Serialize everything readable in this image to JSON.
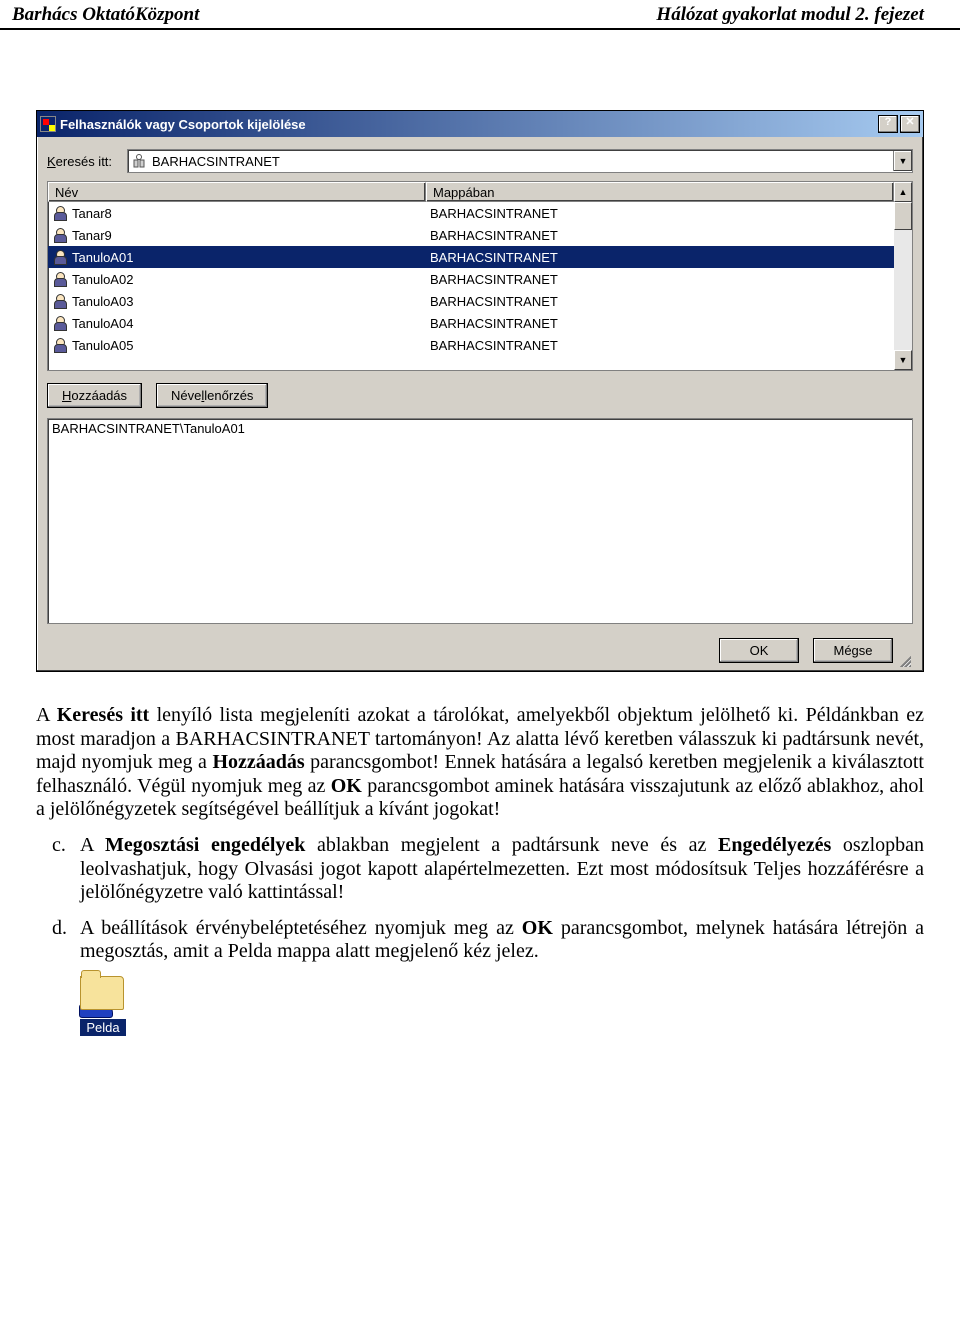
{
  "header": {
    "left": "Barhács OktatóKözpont",
    "right": "Hálózat gyakorlat modul 2. fejezet"
  },
  "dialog": {
    "title": "Felhasználók vagy Csoportok kijelölése",
    "help_btn": "?",
    "close_btn": "✕",
    "search_in_label_pre": "K",
    "search_in_label_post": "eresés itt:",
    "search_in_value": "BARHACSINTRANET",
    "col_name": "Név",
    "col_folder": "Mappában",
    "rows": [
      {
        "name": "Tanar8",
        "folder": "BARHACSINTRANET"
      },
      {
        "name": "Tanar9",
        "folder": "BARHACSINTRANET"
      },
      {
        "name": "TanuloA01",
        "folder": "BARHACSINTRANET"
      },
      {
        "name": "TanuloA02",
        "folder": "BARHACSINTRANET"
      },
      {
        "name": "TanuloA03",
        "folder": "BARHACSINTRANET"
      },
      {
        "name": "TanuloA04",
        "folder": "BARHACSINTRANET"
      },
      {
        "name": "TanuloA05",
        "folder": "BARHACSINTRANET"
      }
    ],
    "selected_index": 2,
    "add_btn_pre": "H",
    "add_btn_post": "ozzáadás",
    "check_btn_pre": "Néve",
    "check_btn_mid": "l",
    "check_btn_post": "lenőrzés",
    "result_text": "BARHACSINTRANET\\TanuloA01",
    "ok_btn": "OK",
    "cancel_btn": "Mégse"
  },
  "text": {
    "p1_a": "A ",
    "p1_b": "Keresés itt",
    "p1_c": " lenyíló lista megjeleníti azokat a tárolókat, amelyekből objektum jelölhető ki. Példánkban ez most maradjon a BARHACSINTRANET tartományon! Az alatta lévő keretben válasszuk ki padtársunk nevét, majd nyomjuk meg a ",
    "p1_d": "Hozzáadás",
    "p1_e": " parancsgombot! Ennek hatására a legalsó keretben megjelenik a kiválasztott felhasználó. Végül nyomjuk meg az ",
    "p1_f": "OK",
    "p1_g": " parancsgombot aminek hatására visszajutunk az előző ablakhoz, ahol a jelölőnégyzetek segítségével beállítjuk a kívánt jogokat!",
    "li_c_letter": "c.",
    "li_c_a": "A ",
    "li_c_b": "Megosztási engedélyek",
    "li_c_c": " ablakban megjelent a padtársunk neve és az ",
    "li_c_d": "Engedélyezés",
    "li_c_e": " oszlopban leolvashatjuk, hogy Olvasási jogot kapott alapértelmezetten. Ezt most módosítsuk Teljes hozzáférésre a jelölőnégyzetre való kattintással!",
    "li_d_letter": "d.",
    "li_d_a": "A beállítások érvénybeléptetéséhez nyomjuk meg az ",
    "li_d_b": "OK",
    "li_d_c": " parancsgombot, melynek hatására létrejön a megosztás, amit a Pelda mappa alatt megjelenő kéz jelez.",
    "folder_label": "Pelda"
  }
}
